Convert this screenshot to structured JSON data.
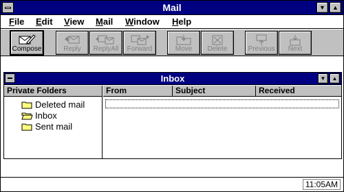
{
  "app": {
    "title": "Mail"
  },
  "menu": [
    {
      "key": "F",
      "rest": "ile"
    },
    {
      "key": "E",
      "rest": "dit"
    },
    {
      "key": "V",
      "rest": "iew"
    },
    {
      "key": "M",
      "rest": "ail"
    },
    {
      "key": "W",
      "rest": "indow"
    },
    {
      "key": "H",
      "rest": "elp"
    }
  ],
  "toolbar": {
    "compose": "Compose",
    "reply": "Reply",
    "reply_all": "ReplyAll",
    "forward": "Forward",
    "move": "Move",
    "delete": "Delete",
    "previous": "Previous",
    "next": "Next"
  },
  "inbox_window": {
    "title": "Inbox",
    "folders_header": "Private Folders",
    "folders": [
      "Deleted mail",
      "Inbox",
      "Sent mail"
    ],
    "columns": [
      "From",
      "Subject",
      "Received"
    ]
  },
  "status": {
    "time": "11:05AM"
  },
  "colors": {
    "titlebar": "#000080",
    "face": "#c0c0c0",
    "disabled_text": "#808080"
  }
}
